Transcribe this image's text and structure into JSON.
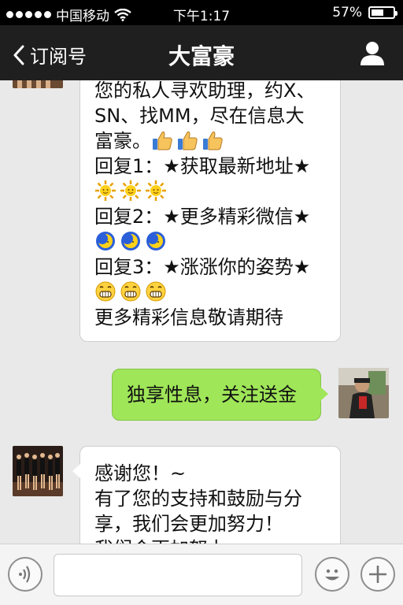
{
  "status_bar": {
    "carrier": "中国移动",
    "time": "下午1:17",
    "battery_text": "57%",
    "battery_level": 0.57
  },
  "nav": {
    "back_label": "订阅号",
    "title": "大富豪"
  },
  "messages": [
    {
      "side": "left",
      "lines": [
        "您的私人寻欢助理，约X、",
        "SN、找MM，尽在信息大",
        "富豪。",
        "回复1：★获取最新地址★",
        "回复2：★更多精彩微信★",
        "回复3：★涨涨你的姿势★",
        "更多精彩信息敬请期待"
      ],
      "emoji_icons": [
        "thumbs-up-icon",
        "sun-icon",
        "moon-icon",
        "grin-icon"
      ]
    },
    {
      "side": "right",
      "text": "独享性息，关注送金"
    },
    {
      "side": "left",
      "lines": [
        "感谢您！~",
        "有了您的支持和鼓励与分",
        "享，我们会更加努力！",
        "我们会更加努力"
      ]
    }
  ],
  "input_bar": {
    "placeholder": ""
  },
  "colors": {
    "nav_background": "#1f1f1f",
    "chat_background": "#e9e9e9",
    "outgoing_bubble": "#9fe658",
    "incoming_bubble": "#ffffff"
  }
}
